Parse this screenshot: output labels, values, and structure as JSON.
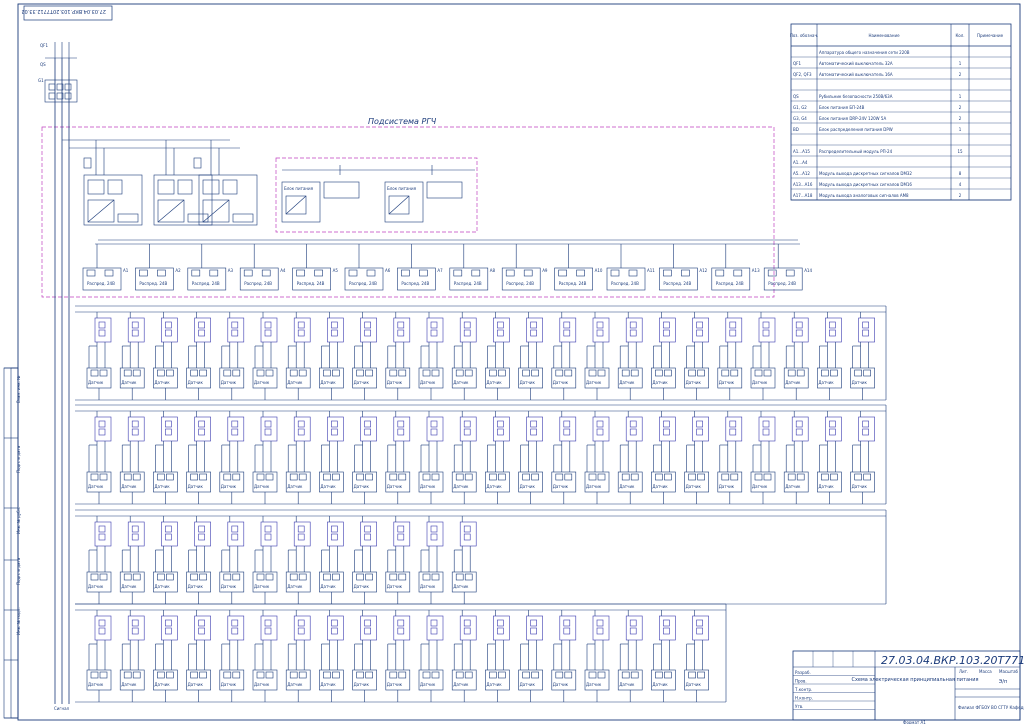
{
  "stamp_code_top": "27.03.04.ВКР.103.20Т7712.33.02",
  "subsystem_title": "Подсистема РГЧ",
  "table": {
    "headers": [
      "Поз. обознач.",
      "Наименование",
      "Кол.",
      "Примечание"
    ],
    "rows": [
      {
        "pos": "",
        "name": "Аппаратура общего назначения сети 220В",
        "qty": "",
        "note": ""
      },
      {
        "pos": "QF1",
        "name": "Автоматический выключатель 32А",
        "qty": "1",
        "note": ""
      },
      {
        "pos": "QF2, QF3",
        "name": "Автоматический выключатель 16А",
        "qty": "2",
        "note": ""
      },
      {
        "pos": "",
        "name": "",
        "qty": "",
        "note": ""
      },
      {
        "pos": "QS",
        "name": "Рубильник безопасности 250В/63А",
        "qty": "1",
        "note": ""
      },
      {
        "pos": "G1, G2",
        "name": "Блок питания БП-24В",
        "qty": "2",
        "note": ""
      },
      {
        "pos": "G3, G4",
        "name": "Блок питания DRP-24V 120W 5A",
        "qty": "2",
        "note": ""
      },
      {
        "pos": "BD",
        "name": "Блок распределения питания DPW",
        "qty": "1",
        "note": ""
      },
      {
        "pos": "",
        "name": "",
        "qty": "",
        "note": ""
      },
      {
        "pos": "A1...A15",
        "name": "Распределительный модуль РП-24",
        "qty": "15",
        "note": ""
      },
      {
        "pos": "A1...A4",
        "name": "",
        "qty": "",
        "note": ""
      },
      {
        "pos": "A5...A12",
        "name": "Модуль выхода дискретных сигналов DM32",
        "qty": "8",
        "note": ""
      },
      {
        "pos": "A13...A16",
        "name": "Модуль выхода дискретных сигналов DM16",
        "qty": "4",
        "note": ""
      },
      {
        "pos": "A17...A18",
        "name": "Модуль выхода аналоговых сигналов AM8",
        "qty": "2",
        "note": ""
      }
    ]
  },
  "labels": {
    "power_block": "Блок питания",
    "distribution": "Распред. 24В",
    "sensor": "Датчик",
    "ground": "Сигнал",
    "format": "Формат А1"
  },
  "title_block": {
    "code": "27.03.04.ВКР.103.20Т7712.33.02",
    "title": "Схема электрическая принципиальная питания",
    "sheet_label": "Э/п",
    "columns": [
      "Лит.",
      "Масса",
      "Масштаб"
    ],
    "roles": [
      "Разраб.",
      "Пров.",
      "Т.контр.",
      "Н.контр.",
      "Утв."
    ],
    "org": "Филиал ФГБОУ ВО СГТУ Кафедра АТП"
  },
  "side_labels": [
    "Взам. инв. №",
    "Подп. и дата",
    "Инв. № дубл.",
    "Подп. и дата",
    "Инв. № подл."
  ]
}
